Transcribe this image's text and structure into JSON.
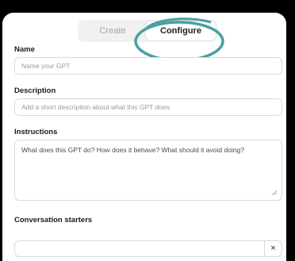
{
  "tabs": {
    "create_label": "Create",
    "configure_label": "Configure",
    "active": "Configure"
  },
  "name": {
    "label": "Name",
    "placeholder": "Name your GPT"
  },
  "description": {
    "label": "Description",
    "placeholder": "Add a short description about what this GPT does"
  },
  "instructions": {
    "label": "Instructions",
    "placeholder": "What does this GPT do? How does it behave? What should it avoid doing?"
  },
  "conversation_starters": {
    "label": "Conversation starters",
    "items": [
      {
        "value": "",
        "remove_label": "×"
      }
    ]
  },
  "colors": {
    "highlight_ring": "#4a9fa0",
    "background": "#000000",
    "panel": "#ffffff"
  },
  "icons": [
    "resize-handle-icon",
    "close-icon"
  ]
}
